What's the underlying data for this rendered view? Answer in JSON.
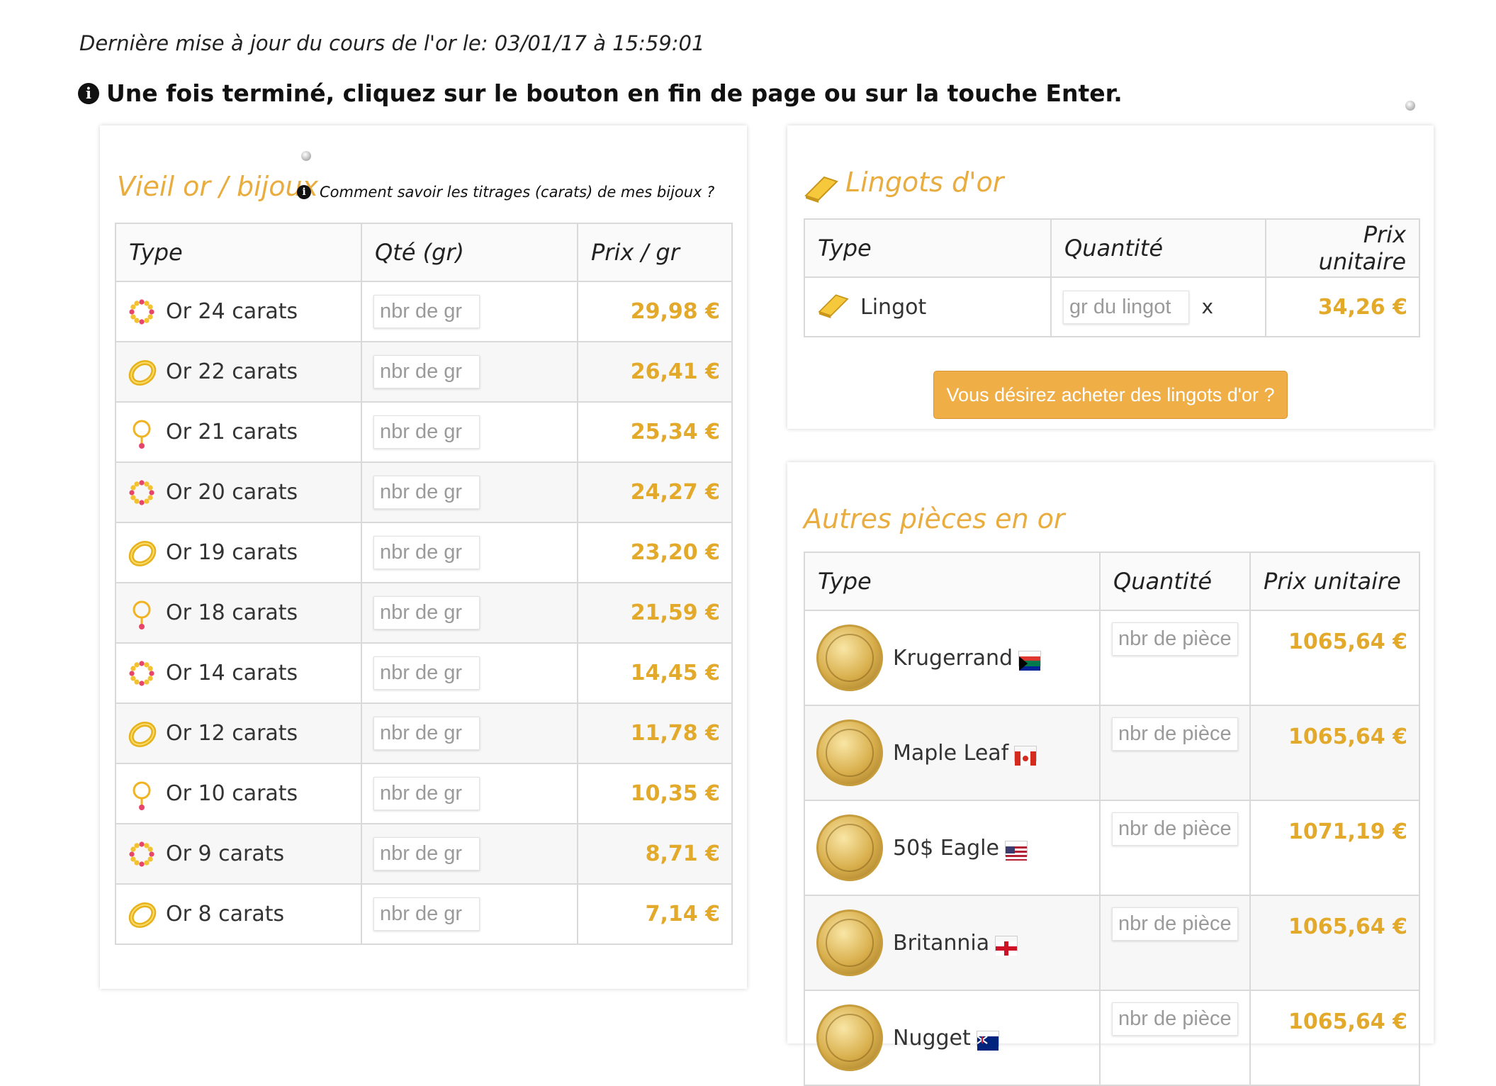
{
  "header": {
    "last_update": "Dernière mise à jour du cours de l'or le: 03/01/17 à 15:59:01",
    "notice": "Une fois terminé, cliquez sur le bouton en fin de page ou sur la touche Enter."
  },
  "jewelry": {
    "title": "Vieil or / bijoux",
    "help_link": "Comment savoir les titrages (carats) de mes bijoux ?",
    "columns": [
      "Type",
      "Qté (gr)",
      "Prix / gr"
    ],
    "placeholder": "nbr de gr",
    "rows": [
      {
        "label": "Or 24 carats",
        "price": "29,98 €",
        "icon": "bracelet-icon"
      },
      {
        "label": "Or 22 carats",
        "price": "26,41 €",
        "icon": "ring-icon"
      },
      {
        "label": "Or 21 carats",
        "price": "25,34 €",
        "icon": "pendant-icon"
      },
      {
        "label": "Or 20 carats",
        "price": "24,27 €",
        "icon": "bracelet-icon"
      },
      {
        "label": "Or 19 carats",
        "price": "23,20 €",
        "icon": "ring-icon"
      },
      {
        "label": "Or 18 carats",
        "price": "21,59 €",
        "icon": "pendant-icon"
      },
      {
        "label": "Or 14 carats",
        "price": "14,45 €",
        "icon": "bracelet-icon"
      },
      {
        "label": "Or 12 carats",
        "price": "11,78 €",
        "icon": "ring-icon"
      },
      {
        "label": "Or 10 carats",
        "price": "10,35 €",
        "icon": "pendant-icon"
      },
      {
        "label": "Or 9 carats",
        "price": "8,71 €",
        "icon": "bracelet-icon"
      },
      {
        "label": "Or 8 carats",
        "price": "7,14 €",
        "icon": "ring-icon"
      }
    ]
  },
  "ingots": {
    "title": "Lingots d'or",
    "columns": [
      "Type",
      "Quantité",
      "Prix unitaire"
    ],
    "row": {
      "label": "Lingot",
      "placeholder": "gr du lingot",
      "multiplier": "x",
      "price": "34,26 €"
    },
    "buy_button": "Vous désirez acheter des lingots d'or ?"
  },
  "coins": {
    "title": "Autres pièces en or",
    "columns": [
      "Type",
      "Quantité",
      "Prix unitaire"
    ],
    "placeholder": "nbr de pièce",
    "rows": [
      {
        "label": "Krugerrand",
        "price": "1065,64 €",
        "flag": "south-africa-flag-icon"
      },
      {
        "label": "Maple Leaf",
        "price": "1065,64 €",
        "flag": "canada-flag-icon"
      },
      {
        "label": "50$ Eagle",
        "price": "1071,19 €",
        "flag": "usa-flag-icon"
      },
      {
        "label": "Britannia",
        "price": "1065,64 €",
        "flag": "england-flag-icon"
      },
      {
        "label": "Nugget",
        "price": "1065,64 €",
        "flag": "australia-flag-icon"
      }
    ]
  },
  "colors": {
    "accent": "#e9ac3f",
    "price": "#e2a92b",
    "button": "#f0ae46"
  }
}
